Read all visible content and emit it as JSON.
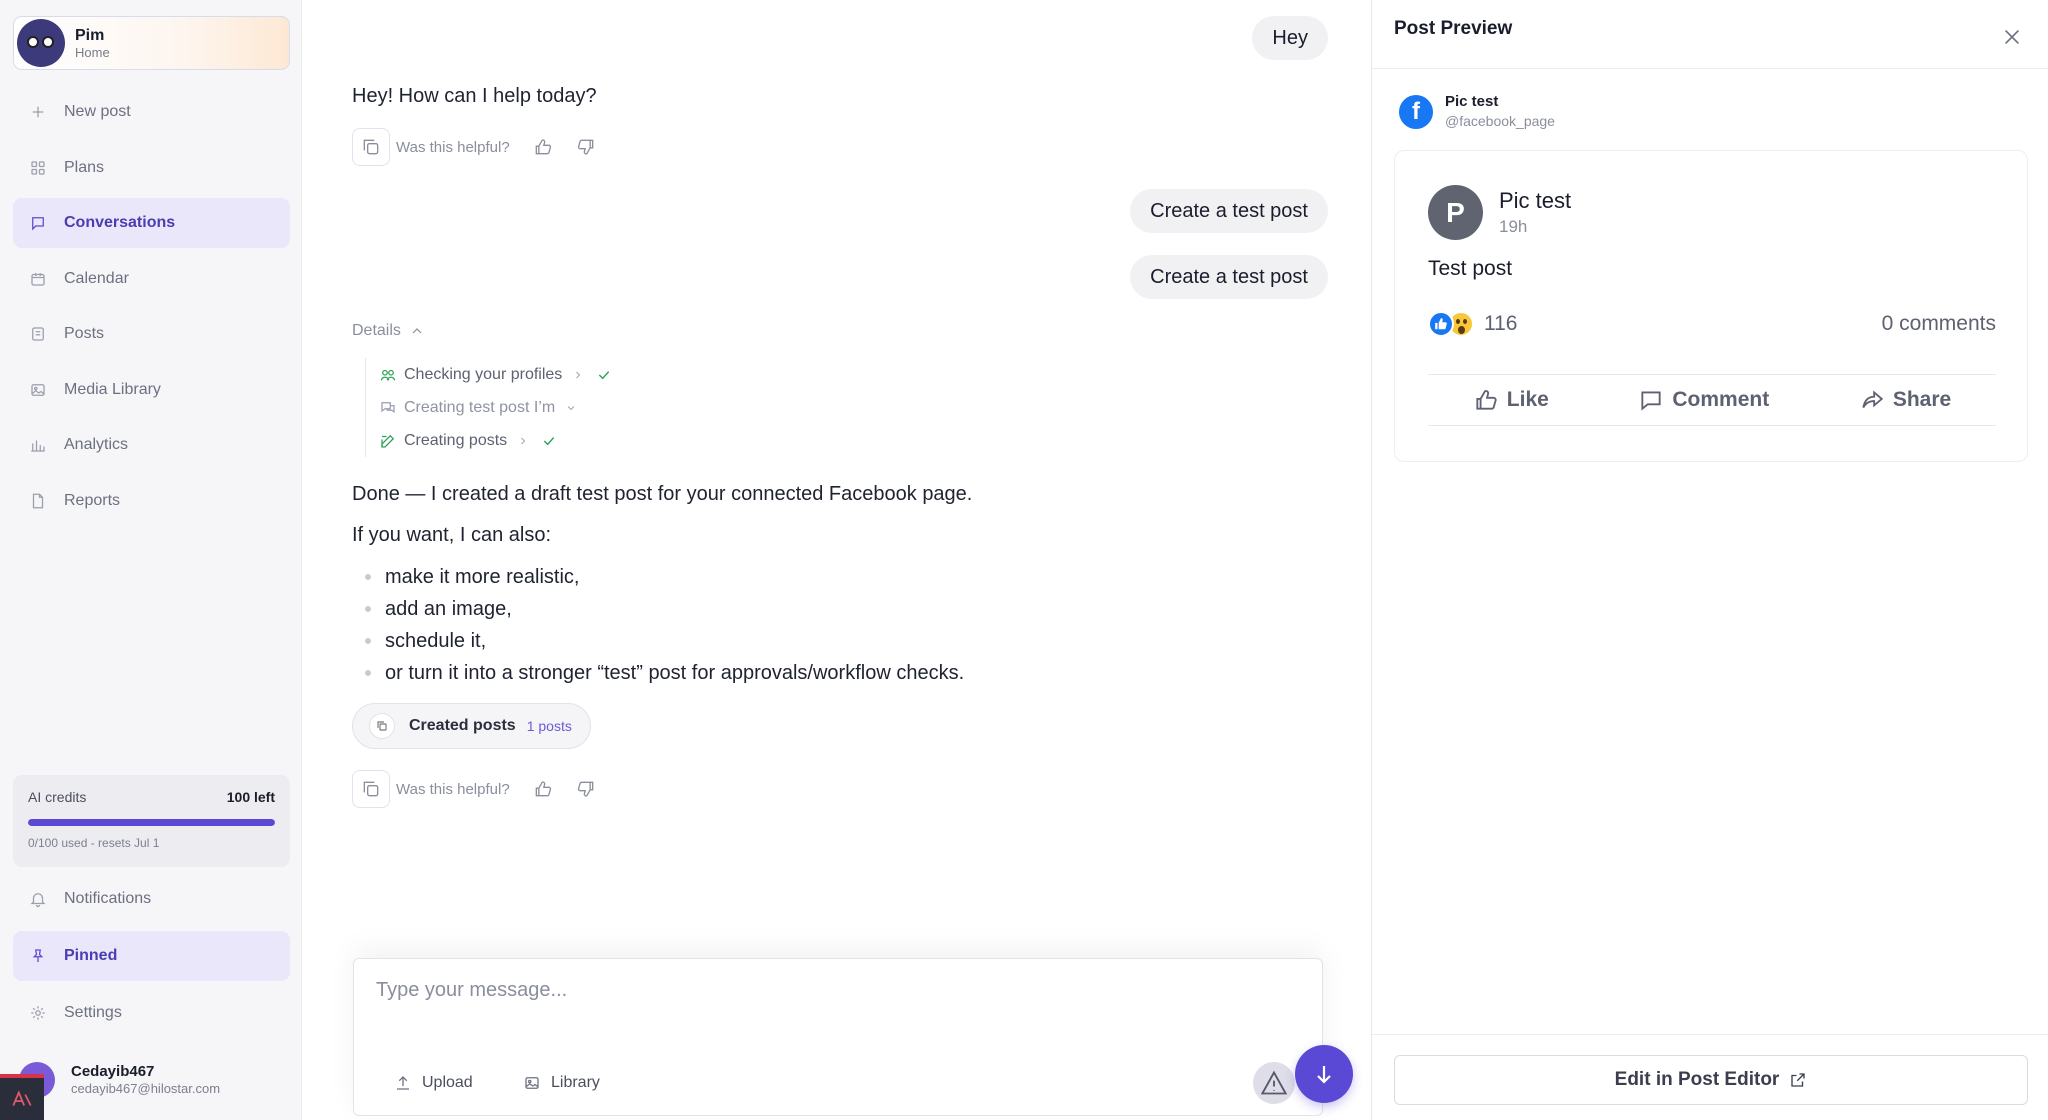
{
  "brand": {
    "name": "Pim",
    "subtitle": "Home"
  },
  "nav": {
    "new_post": "New post",
    "plans": "Plans",
    "conversations": "Conversations",
    "calendar": "Calendar",
    "posts": "Posts",
    "media_library": "Media Library",
    "analytics": "Analytics",
    "reports": "Reports",
    "notifications": "Notifications",
    "pinned": "Pinned",
    "settings": "Settings"
  },
  "credits": {
    "label": "AI credits",
    "left": "100 left",
    "usage_fraction": 1.0,
    "sub": "0/100 used - resets Jul 1"
  },
  "user": {
    "name": "Cedayib467",
    "email": "cedayib467@hilostar.com"
  },
  "chat": {
    "msg1_user": "Hey",
    "msg1_ai": "Hey! How can I help today?",
    "helpful_label": "Was this helpful?",
    "msg2_user": "Create a test post",
    "msg3_user": "Create a test post",
    "details_label": "Details",
    "steps": [
      {
        "label": "Checking your profiles"
      },
      {
        "label": "Creating test post I’m"
      },
      {
        "label": "Creating posts"
      }
    ],
    "done_text": "Done — I created a draft test post for your connected Facebook page.",
    "if_text": "If you want, I can also:",
    "bullets": [
      "make it more realistic,",
      "add an image,",
      "schedule it,",
      "or turn it into a stronger “test” post for approvals/workflow checks."
    ],
    "chip_label": "Created posts",
    "chip_count": "1 posts"
  },
  "composer": {
    "placeholder": "Type your message...",
    "upload": "Upload",
    "library": "Library"
  },
  "preview": {
    "title": "Post Preview",
    "page_name": "Pic test",
    "page_handle": "@facebook_page",
    "post_avatar_letter": "P",
    "post_author": "Pic test",
    "post_time": "19h",
    "post_text": "Test post",
    "reaction_count": "116",
    "comments": "0 comments",
    "like": "Like",
    "comment": "Comment",
    "share": "Share",
    "edit_button": "Edit in Post Editor"
  },
  "colors": {
    "accent": "#5a49d4",
    "active_nav_bg": "#ebe7fb",
    "facebook": "#1877f2",
    "success": "#2fa35a"
  }
}
